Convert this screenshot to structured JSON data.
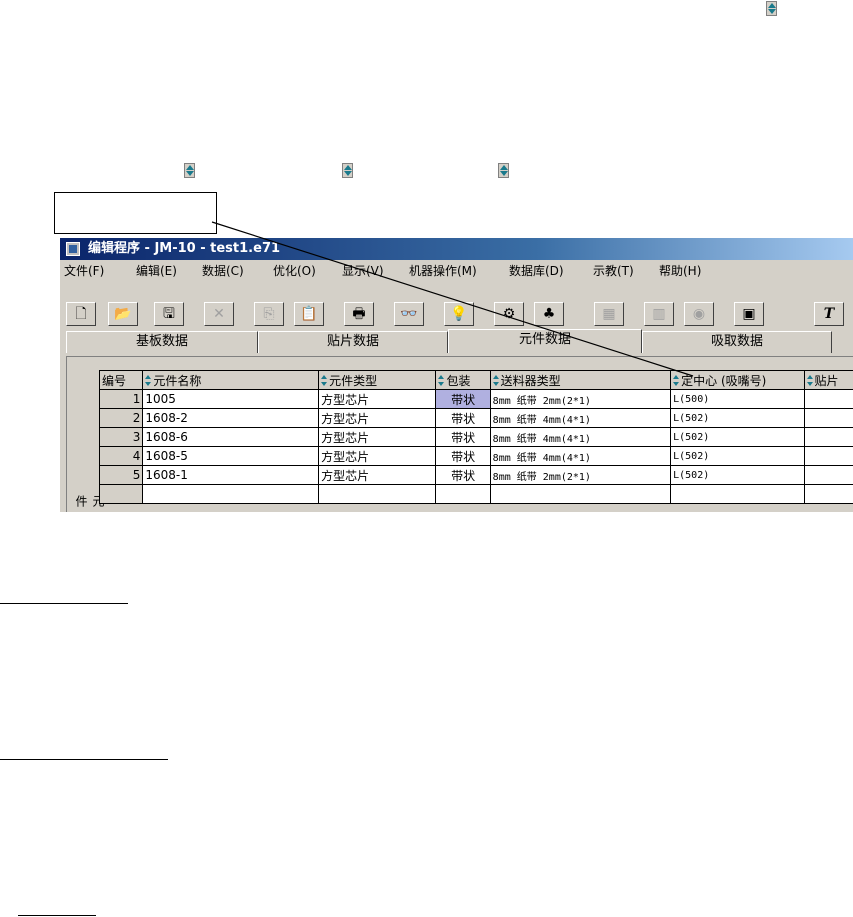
{
  "window": {
    "title": "编辑程序 - JM-10 - test1.e71"
  },
  "menu": [
    "文件(F)",
    "编辑(E)",
    "数据(C)",
    "优化(O)",
    "显示(V)",
    "机器操作(M)",
    "数据库(D)",
    "示教(T)",
    "帮助(H)"
  ],
  "toolbar": {
    "icons": [
      "new-file-icon",
      "open-folder-icon",
      "save-icon",
      "delete-icon",
      "copy-icon",
      "paste-icon",
      "print-icon",
      "find-icon",
      "light-icon",
      "nozzle-icon",
      "components-icon",
      "board-icon",
      "feeder-icon",
      "part-icon",
      "center-icon",
      "text-icon"
    ],
    "glyphs": [
      "🗋",
      "📂",
      "🖫",
      "✕",
      "⎘",
      "📋",
      "🖶",
      "👓",
      "💡",
      "⚙",
      "♣",
      "▦",
      "▥",
      "◉",
      "▣",
      "T"
    ]
  },
  "tabs": [
    "基板数据",
    "贴片数据",
    "元件数据",
    "吸取数据"
  ],
  "side_label": "元件",
  "grid": {
    "headers": [
      "编号",
      "元件名称",
      "元件类型",
      "包装",
      "送料器类型",
      "定中心 (吸嘴号)",
      "贴片"
    ],
    "rows": [
      {
        "no": "1",
        "name": "1005",
        "type": "方型芯片",
        "pkg": "带状",
        "feeder": "8mm 纸带  2mm(2*1)",
        "center": "L(500)"
      },
      {
        "no": "2",
        "name": "1608-2",
        "type": "方型芯片",
        "pkg": "带状",
        "feeder": "8mm 纸带  4mm(4*1)",
        "center": "L(502)"
      },
      {
        "no": "3",
        "name": "1608-6",
        "type": "方型芯片",
        "pkg": "带状",
        "feeder": "8mm 纸带  4mm(4*1)",
        "center": "L(502)"
      },
      {
        "no": "4",
        "name": "1608-5",
        "type": "方型芯片",
        "pkg": "带状",
        "feeder": "8mm 纸带  4mm(4*1)",
        "center": "L(502)"
      },
      {
        "no": "5",
        "name": "1608-1",
        "type": "方型芯片",
        "pkg": "带状",
        "feeder": "8mm 纸带  2mm(2*1)",
        "center": "L(502)"
      }
    ]
  },
  "colors": {
    "title_bar": "#0a246a",
    "window_bg": "#d4d0c8",
    "sort_icon": "#1a7a8c",
    "selected_cell": "#b0b0e0"
  }
}
